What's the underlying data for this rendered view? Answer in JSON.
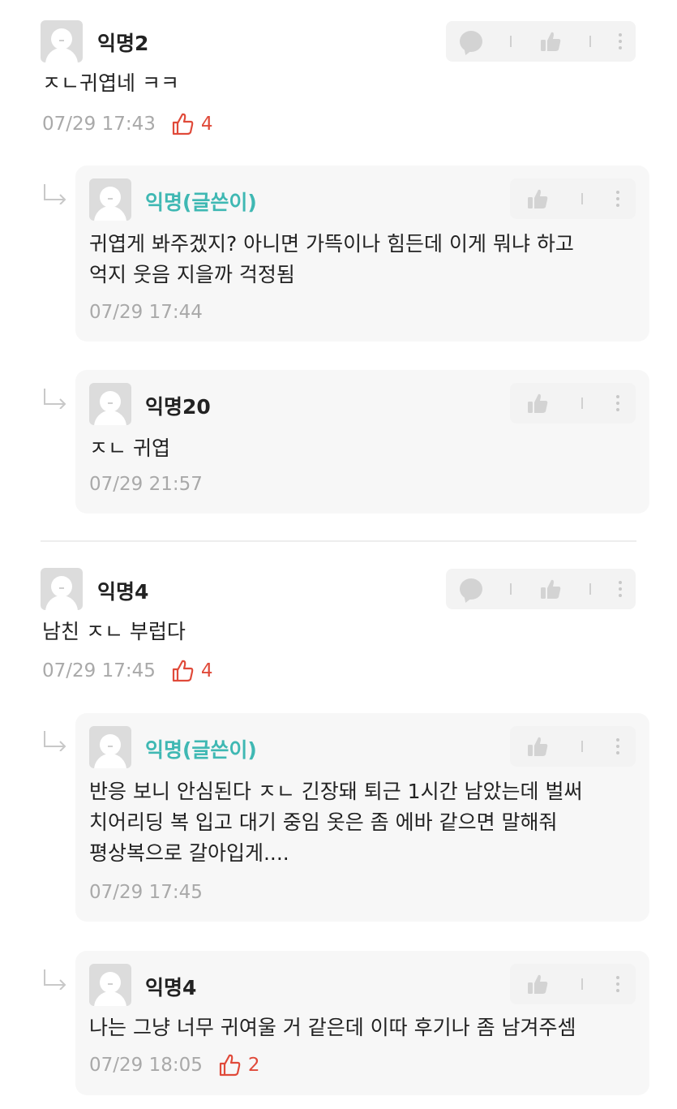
{
  "comments": [
    {
      "name": "익명2",
      "text": "ㅈㄴ귀엽네 ㅋㅋ",
      "time": "07/29 17:43",
      "likes": "4",
      "replies": [
        {
          "name": "익명(글쓴이)",
          "lines": [
            "귀엽게 봐주겠지? 아니면 가뜩이나 힘든데 이게 뭐냐 하고",
            "억지 웃음 지을까 걱정됨"
          ],
          "time": "07/29 17:44"
        },
        {
          "name": "익명20",
          "lines": [
            "ㅈㄴ 귀엽"
          ],
          "time": "07/29 21:57"
        }
      ]
    },
    {
      "name": "익명4",
      "text": "남친 ㅈㄴ 부럽다",
      "time": "07/29 17:45",
      "likes": "4",
      "replies": [
        {
          "name": "익명(글쓴이)",
          "lines": [
            "반응 보니 안심된다 ㅈㄴ 긴장돼 퇴근 1시간 남았는데 벌써",
            "치어리딩 복 입고 대기 중임 옷은 좀 에바 같으면 말해줘",
            "평상복으로 갈아입게...."
          ],
          "time": "07/29 17:45"
        },
        {
          "name": "익명4",
          "lines": [
            "나는 그냥 너무 귀여울 거 같은데 이따 후기나 좀 남겨주셈"
          ],
          "time": "07/29 18:05",
          "likes": "2"
        }
      ]
    }
  ],
  "icons": {
    "comment": "comment-bubble-icon",
    "like": "thumbs-up-icon",
    "more": "more-vertical-icon",
    "reply": "reply-arrow-icon",
    "heart_like": "outline-like-icon"
  },
  "colors": {
    "author_name": "#3fb8b3",
    "like_count": "#e04a3a",
    "meta_text": "#a9a9a9",
    "reply_bg": "#f7f7f7",
    "action_bg": "#f3f3f3"
  }
}
